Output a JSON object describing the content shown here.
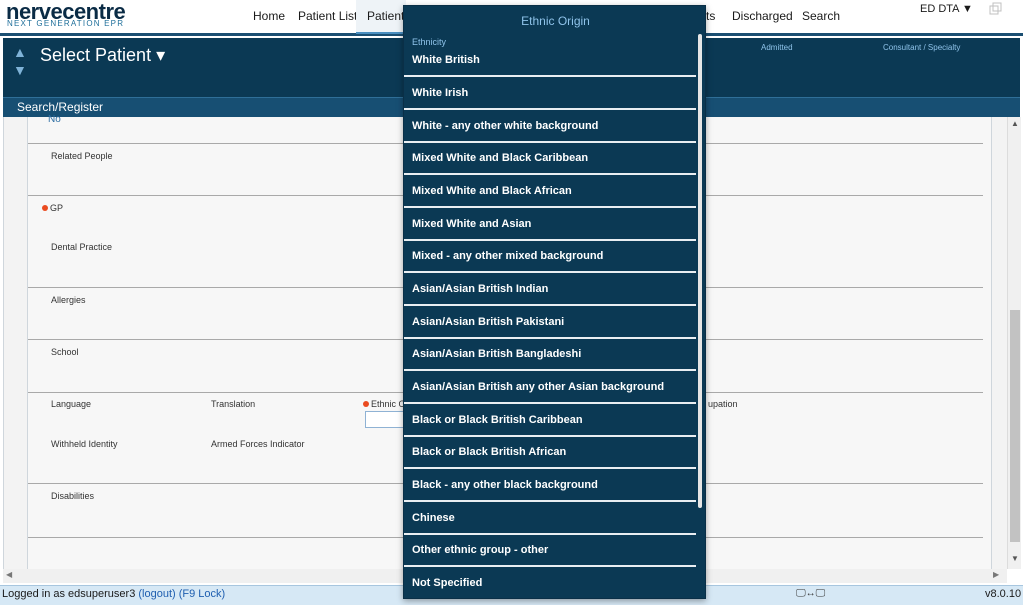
{
  "brand": {
    "name": "nervecentre",
    "tagline": "NEXT GENERATION EPR"
  },
  "nav": {
    "items": [
      {
        "label": "Home"
      },
      {
        "label": "Patient List"
      },
      {
        "label": "Patient"
      },
      {
        "label": "ts"
      },
      {
        "label": "Discharged"
      },
      {
        "label": "Search"
      }
    ],
    "role": "ED DTA ▼"
  },
  "patient_header": {
    "select_patient": "Select Patient ▾",
    "columns": {
      "admitted": "Admitted",
      "consultant": "Consultant / Specialty"
    }
  },
  "section": {
    "title": "Search/Register"
  },
  "form": {
    "top_value": "No",
    "fields": {
      "related_people": "Related People",
      "gp": "GP",
      "dental_practice": "Dental Practice",
      "allergies": "Allergies",
      "school": "School",
      "language": "Language",
      "translation": "Translation",
      "ethnic_origin": "Ethnic O",
      "occupation": "upation",
      "withheld_identity": "Withheld Identity",
      "armed_forces": "Armed Forces Indicator",
      "disabilities": "Disabilities"
    }
  },
  "dropdown": {
    "title": "Ethnic Origin",
    "subtitle": "Ethnicity",
    "options": [
      "White British",
      "White Irish",
      "White - any other white background",
      "Mixed White and Black Caribbean",
      "Mixed White and Black African",
      "Mixed White and Asian",
      "Mixed - any other mixed background",
      "Asian/Asian British Indian",
      "Asian/Asian British Pakistani",
      "Asian/Asian British Bangladeshi",
      "Asian/Asian British any other Asian background",
      "Black or Black British Caribbean",
      "Black or Black British African",
      "Black - any other black background",
      "Chinese",
      "Other ethnic group - other",
      "Not Specified"
    ]
  },
  "status": {
    "login_prefix": "Logged in as edsuperuser3",
    "logout": "(logout)",
    "lock": "(F9 Lock)",
    "version": "v8.0.10",
    "monitor_icon": "🖵↔🖵"
  },
  "colors": {
    "header_bg": "#0b3954",
    "accent": "#8fc3ea",
    "required": "#ea4b20"
  }
}
